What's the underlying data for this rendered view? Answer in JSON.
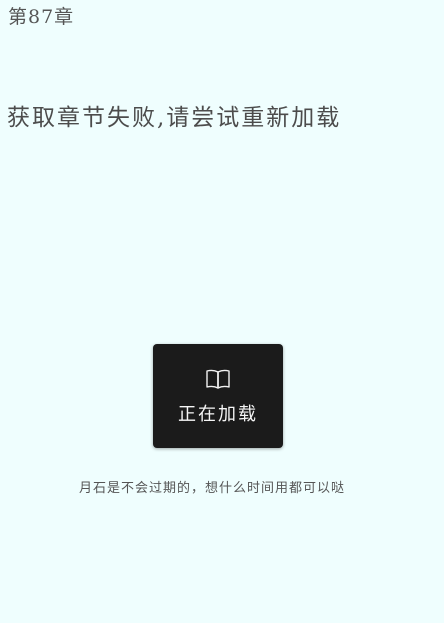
{
  "chapter": {
    "title": "第87章"
  },
  "error": {
    "message": "获取章节失败,请尝试重新加载"
  },
  "loading": {
    "icon": "book-icon",
    "text": "正在加载"
  },
  "footer": {
    "quote": "月石是不会过期的，想什么时间用都可以哒"
  },
  "colors": {
    "background": "#effefe",
    "loading_box": "#1b1b1b",
    "text": "#4c4c4c"
  }
}
